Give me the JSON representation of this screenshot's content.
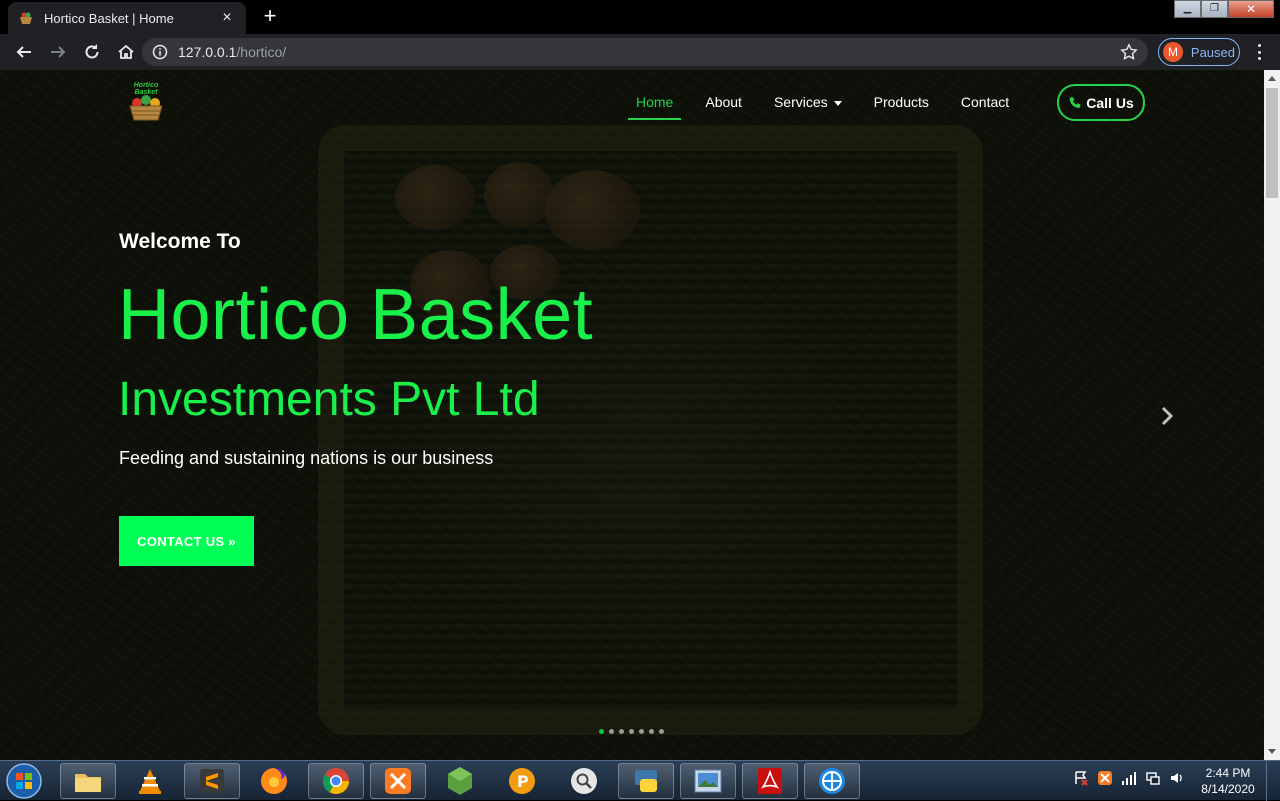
{
  "browser": {
    "tab_title": "Hortico Basket | Home",
    "close_tab": "×",
    "new_tab": "+",
    "url_host": "127.0.0.1",
    "url_path": "/hortico/",
    "profile_initial": "M",
    "profile_status": "Paused"
  },
  "site": {
    "logo_text": "Hortico Basket",
    "nav": [
      {
        "label": "Home",
        "active": true
      },
      {
        "label": "About"
      },
      {
        "label": "Services",
        "dropdown": true
      },
      {
        "label": "Products"
      },
      {
        "label": "Contact"
      }
    ],
    "call_label": "Call Us",
    "accent_color": "#19f04a"
  },
  "hero": {
    "welcome": "Welcome To",
    "title": "Hortico Basket",
    "subtitle": "Investments Pvt Ltd",
    "tagline": "Feeding and sustaining nations is our business",
    "cta_label": "CONTACT US »",
    "slide_count": 7,
    "active_slide": 1
  },
  "taskbar": {
    "apps": [
      "file-explorer",
      "vlc",
      "sublime-text",
      "firefox",
      "chrome",
      "xampp",
      "node",
      "pixel-app",
      "search-app",
      "python",
      "image-viewer",
      "acrobat",
      "network-app"
    ],
    "time": "2:44 PM",
    "date": "8/14/2020"
  }
}
